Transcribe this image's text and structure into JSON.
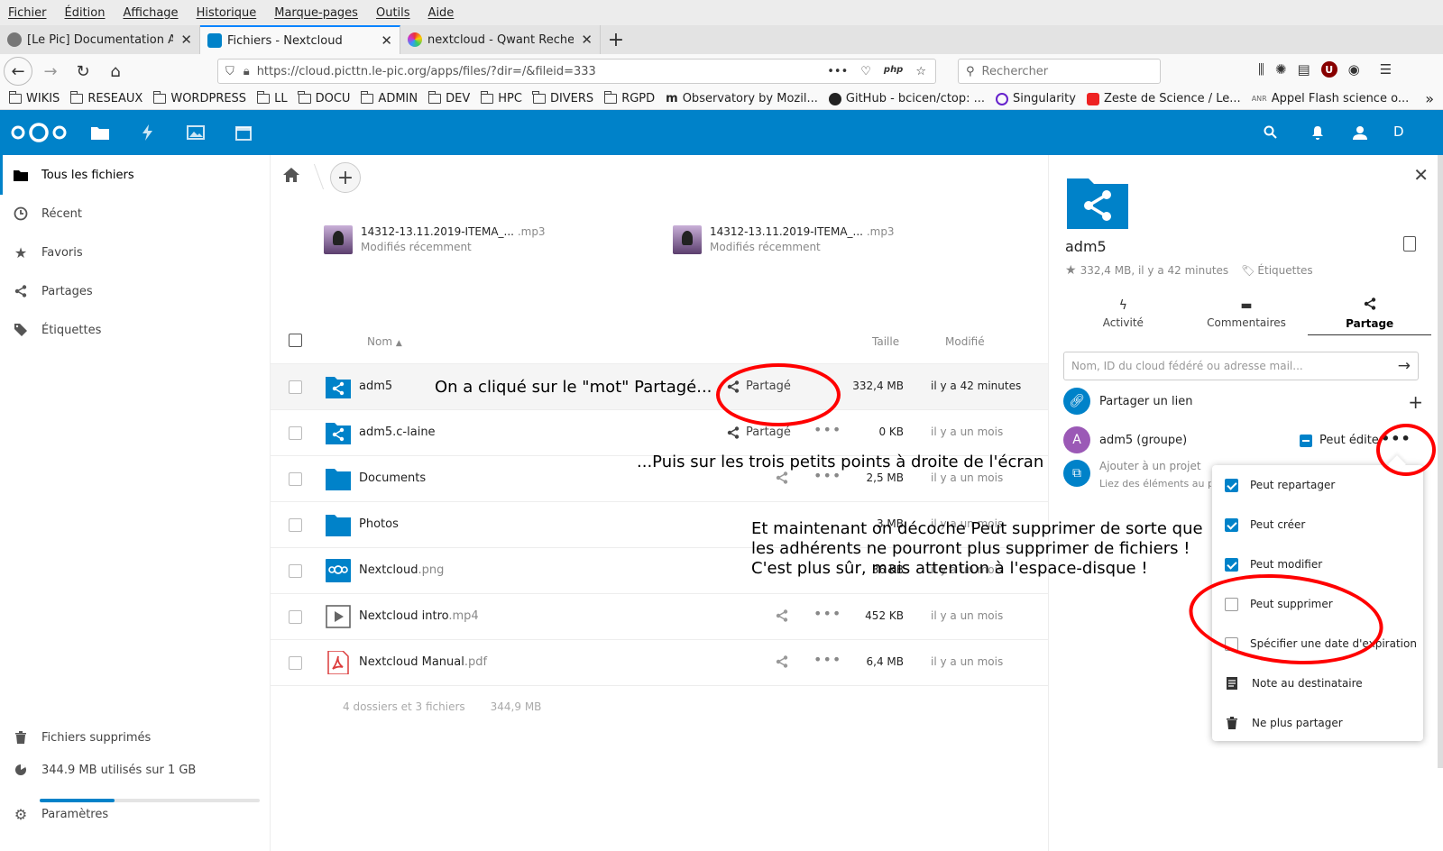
{
  "browser": {
    "menu": [
      "Fichier",
      "Édition",
      "Affichage",
      "Historique",
      "Marque-pages",
      "Outils",
      "Aide"
    ],
    "tabs": [
      {
        "label": "[Le Pic] Documentation Adm",
        "active": false
      },
      {
        "label": "Fichiers - Nextcloud",
        "active": true
      },
      {
        "label": "nextcloud - Qwant Recherche",
        "active": false
      }
    ],
    "url": "https://cloud.picttn.le-pic.org/apps/files/?dir=/&fileid=333",
    "search_placeholder": "Rechercher",
    "bookmarks": [
      "WIKIS",
      "RESEAUX",
      "WORDPRESS",
      "LL",
      "DOCU",
      "ADMIN",
      "DEV",
      "HPC",
      "DIVERS",
      "RGPD",
      "Observatory by Mozil...",
      "GitHub - bcicen/ctop: ...",
      "Singularity",
      "Zeste de Science / Le...",
      "Appel Flash science o..."
    ]
  },
  "header": {
    "avatar_letter": "D",
    "accent": "#0082c9"
  },
  "nav": {
    "items": [
      "Tous les fichiers",
      "Récent",
      "Favoris",
      "Partages",
      "Étiquettes"
    ],
    "trash": "Fichiers supprimés",
    "quota": "344.9 MB utilisés sur 1 GB",
    "quota_fraction": 0.34,
    "settings": "Paramètres"
  },
  "recent": [
    {
      "name": "14312-13.11.2019-ITEMA_...",
      "ext": " .mp3",
      "sub": "Modifiés récemment"
    },
    {
      "name": "14312-13.11.2019-ITEMA_...",
      "ext": " .mp3",
      "sub": "Modifiés récemment"
    }
  ],
  "list": {
    "col_name": "Nom",
    "col_size": "Taille",
    "col_modified": "Modifié",
    "rows": [
      {
        "name": "adm5",
        "ext": "",
        "share": "Partagé",
        "size": "332,4 MB",
        "date": "il y a 42 minutes",
        "icon": "shared-folder-icon",
        "selected": true
      },
      {
        "name": "adm5.c-laine",
        "ext": "",
        "share": "Partagé",
        "size": "0 KB",
        "date": "il y a un mois",
        "icon": "shared-folder-icon",
        "selected": false
      },
      {
        "name": "Documents",
        "ext": "",
        "share": "",
        "size": "2,5 MB",
        "date": "il y a un mois",
        "icon": "folder-icon",
        "selected": false
      },
      {
        "name": "Photos",
        "ext": "",
        "share": "",
        "size": "3 MB",
        "date": "il y a un mois",
        "icon": "folder-icon",
        "selected": false
      },
      {
        "name": "Nextcloud",
        "ext": ".png",
        "share": "",
        "size": "36 KB",
        "date": "il y a un mois",
        "icon": "image-file-icon",
        "selected": false
      },
      {
        "name": "Nextcloud intro",
        "ext": ".mp4",
        "share": "",
        "size": "452 KB",
        "date": "il y a un mois",
        "icon": "video-file-icon",
        "selected": false
      },
      {
        "name": "Nextcloud Manual",
        "ext": ".pdf",
        "share": "",
        "size": "6,4 MB",
        "date": "il y a un mois",
        "icon": "pdf-file-icon",
        "selected": false
      }
    ],
    "summary_count": "4 dossiers et 3 fichiers",
    "summary_size": "344,9 MB"
  },
  "sidebar": {
    "title": "adm5",
    "meta": "332,4 MB, il y a 42 minutes",
    "tags": "Étiquettes",
    "tabs": [
      "Activité",
      "Commentaires",
      "Partage"
    ],
    "search_placeholder": "Nom, ID du cloud fédéré ou adresse mail...",
    "share_link": "Partager un lien",
    "share_group": "adm5 (groupe)",
    "group_avatar": "A",
    "can_edit": "Peut éditer",
    "project_title": "Ajouter à un projet",
    "project_sub": "Liez des éléments au projet"
  },
  "popup": {
    "items": [
      {
        "label": "Peut repartager",
        "type": "check",
        "checked": true
      },
      {
        "label": "Peut créer",
        "type": "check",
        "checked": true
      },
      {
        "label": "Peut modifier",
        "type": "check",
        "checked": true
      },
      {
        "label": "Peut supprimer",
        "type": "check",
        "checked": false
      },
      {
        "label": "Spécifier une date d'expiration",
        "type": "check",
        "checked": false
      },
      {
        "label": "Note au destinataire",
        "type": "icon",
        "icon": "note-icon"
      },
      {
        "label": "Ne plus partager",
        "type": "icon",
        "icon": "trash-icon"
      }
    ]
  },
  "annotations": {
    "a1": "On a cliqué sur le \"mot\" Partagé...",
    "a2": "...Puis sur les trois petits points à droite de l'écran",
    "a3_l1": "Et maintenant on décoche Peut supprimer de sorte que",
    "a3_l2": "les adhérents ne pourront plus supprimer de fichiers !",
    "a3_l3": "C'est plus sûr, mais attention à l'espace-disque !"
  }
}
